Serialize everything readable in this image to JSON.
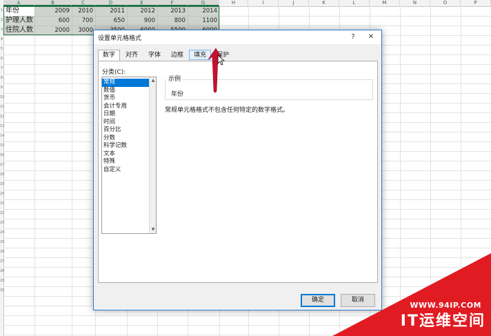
{
  "sheet": {
    "columns": [
      "A",
      "B",
      "C",
      "D",
      "E",
      "F",
      "G",
      "H",
      "I",
      "J",
      "K",
      "L",
      "M",
      "N",
      "O",
      "P"
    ],
    "rows": [
      {
        "label": "年份",
        "values": [
          "2009",
          "2010",
          "2011",
          "2012",
          "2013",
          "2014"
        ]
      },
      {
        "label": "护理人数",
        "values": [
          "600",
          "700",
          "650",
          "900",
          "800",
          "1100"
        ]
      },
      {
        "label": "住院人数",
        "values": [
          "2000",
          "3000",
          "3500",
          "6000",
          "5500",
          "6000"
        ]
      }
    ],
    "row_numbers": [
      "1",
      "2",
      "3",
      "4",
      "5",
      "6",
      "7",
      "8",
      "9",
      "10",
      "11",
      "12",
      "13",
      "14",
      "15",
      "16",
      "17",
      "18",
      "19",
      "20",
      "21",
      "22",
      "23",
      "24",
      "25",
      "26",
      "27",
      "28",
      "29",
      "30"
    ]
  },
  "dialog": {
    "title": "设置单元格格式",
    "help": "?",
    "close": "✕",
    "tabs": [
      {
        "label": "数字"
      },
      {
        "label": "对齐"
      },
      {
        "label": "字体"
      },
      {
        "label": "边框"
      },
      {
        "label": "填充"
      },
      {
        "label": "保护"
      }
    ],
    "category_label": "分类(C):",
    "categories": [
      "常规",
      "数值",
      "货币",
      "会计专用",
      "日期",
      "时间",
      "百分比",
      "分数",
      "科学记数",
      "文本",
      "特殊",
      "自定义"
    ],
    "selected_category": "常规",
    "sample_label": "示例",
    "sample_value": "年份",
    "description": "常规单元格格式不包含任何特定的数字格式。",
    "ok": "确定",
    "cancel": "取消"
  },
  "watermark": {
    "url": "WWW.94IP.COM",
    "name": "IT运维空间"
  },
  "colors": {
    "accent": "#0078d7",
    "excel_green": "#217346",
    "arrow_red": "#c8102e",
    "watermark_red": "#e11b22"
  }
}
